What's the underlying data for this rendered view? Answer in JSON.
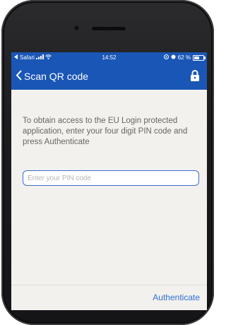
{
  "status": {
    "carrier": "Safari",
    "time": "14:52",
    "battery": "62 %",
    "battery_level": 0.62
  },
  "nav": {
    "back_label": "Scan QR code"
  },
  "main": {
    "instructions": "To obtain access to the EU Login protected application, enter your four digit PIN code and press Authenticate",
    "pin_placeholder": "Enter your PIN code"
  },
  "footer": {
    "authenticate_label": "Authenticate"
  },
  "colors": {
    "accent": "#1a56b6",
    "link": "#2d6fd4"
  }
}
